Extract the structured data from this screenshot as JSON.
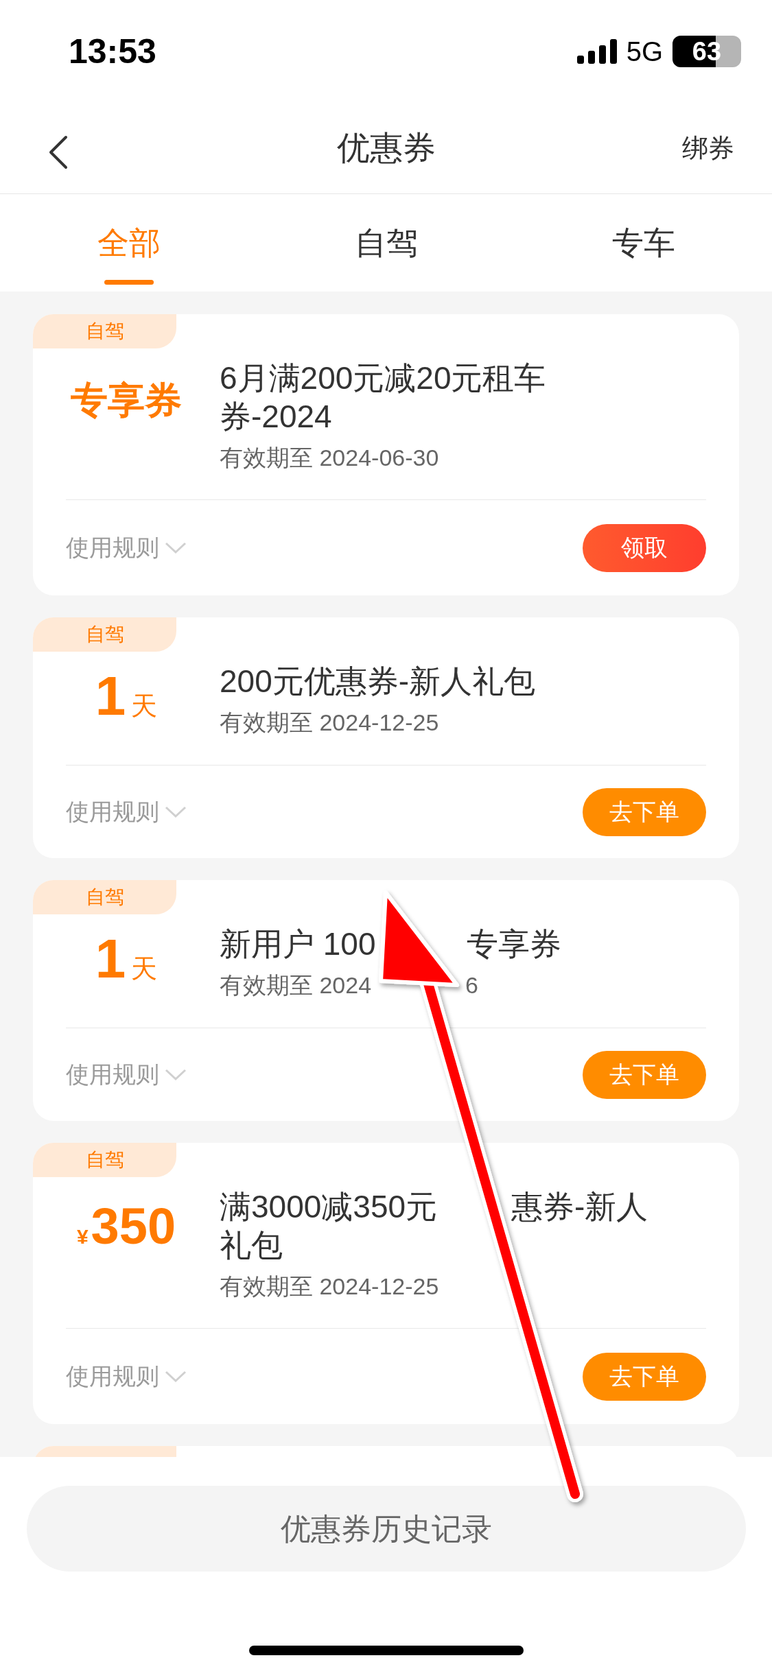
{
  "status_bar": {
    "time": "13:53",
    "network": "5G",
    "battery": "63"
  },
  "nav": {
    "title": "优惠券",
    "action": "绑券"
  },
  "tabs": [
    {
      "label": "全部",
      "selected": true
    },
    {
      "label": "自驾",
      "selected": false
    },
    {
      "label": "专车",
      "selected": false
    }
  ],
  "cards": [
    {
      "tag": "自驾",
      "value": {
        "kind": "text",
        "main": "专享券"
      },
      "title_parts": [
        "6月满200元减20元租车券-2024"
      ],
      "date_parts": [
        "有效期至 2024-06-30"
      ],
      "rules": "使用规则",
      "action": {
        "kind": "claim",
        "label": "领取"
      }
    },
    {
      "tag": "自驾",
      "value": {
        "kind": "days",
        "main": "1",
        "unit": "天"
      },
      "title_parts": [
        "200元优惠券-新人礼包"
      ],
      "date_parts": [
        "有效期至 2024-12-25"
      ],
      "rules": "使用规则",
      "action": {
        "kind": "order",
        "label": "去下单"
      }
    },
    {
      "tag": "自驾",
      "value": {
        "kind": "days",
        "main": "1",
        "unit": "天"
      },
      "title_parts": [
        "新用户 100",
        "专享券"
      ],
      "date_parts": [
        "有效期至 2024",
        "6"
      ],
      "rules": "使用规则",
      "action": {
        "kind": "order",
        "label": "去下单"
      }
    },
    {
      "tag": "自驾",
      "value": {
        "kind": "amount",
        "main": "350",
        "unit": "¥"
      },
      "title_parts": [
        "满3000减350元",
        "惠券-新人",
        "礼包"
      ],
      "date_parts": [
        "有效期至 2024-12-25"
      ],
      "rules": "使用规则",
      "action": {
        "kind": "order",
        "label": "去下单"
      }
    }
  ],
  "history_button": "优惠券历史记录"
}
